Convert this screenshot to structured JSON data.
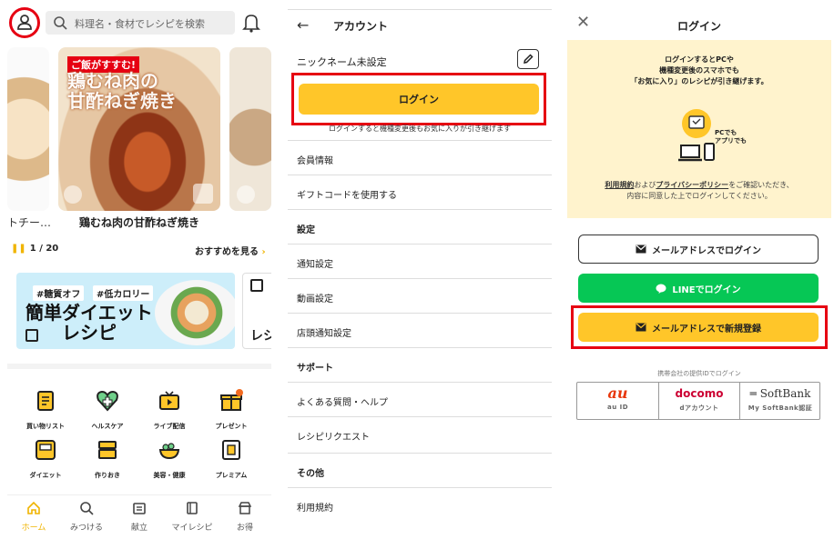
{
  "home": {
    "search_placeholder": "料理名・食材でレシピを検索",
    "featured_badge": "ご飯がすすむ!",
    "featured_title_line1": "鶏むね肉の",
    "featured_title_line2": "甘酢ねぎ焼き",
    "featured_caption": "鶏むね肉の甘酢ねぎ焼き",
    "left_caption": "トチー…",
    "pager": "1 / 20",
    "see_more": "おすすめを見る",
    "banner_tag1": "#糖質オフ",
    "banner_tag2": "#低カロリー",
    "banner_title_line1": "簡単ダイエット",
    "banner_title_line2": "レシピ",
    "banner2_text": "レシ",
    "grid": [
      {
        "label": "買い物リスト",
        "icon": "shopping-list-icon"
      },
      {
        "label": "ヘルスケア",
        "icon": "healthcare-icon"
      },
      {
        "label": "ライブ配信",
        "icon": "live-tv-icon"
      },
      {
        "label": "プレゼント",
        "icon": "present-icon",
        "badge": "N"
      },
      {
        "label": "ダイエット",
        "icon": "scale-icon"
      },
      {
        "label": "作りおき",
        "icon": "containers-icon"
      },
      {
        "label": "美容・健康",
        "icon": "salad-bowl-icon"
      },
      {
        "label": "プレミアム",
        "icon": "premium-icon"
      }
    ],
    "tabs": [
      "ホーム",
      "みつける",
      "献立",
      "マイレシピ",
      "お得"
    ],
    "accent": "#f0b400",
    "highlight": "#e60012"
  },
  "account": {
    "title": "アカウント",
    "nickname": "ニックネーム未設定",
    "login_label": "ログイン",
    "login_note": "ログインすると機種変更後もお気に入りが引き継げます",
    "menu": [
      {
        "label": "会員情報",
        "section": false
      },
      {
        "label": "ギフトコードを使用する",
        "section": false
      },
      {
        "label": "設定",
        "section": true
      },
      {
        "label": "通知設定",
        "section": false
      },
      {
        "label": "動画設定",
        "section": false
      },
      {
        "label": "店頭通知設定",
        "section": false
      },
      {
        "label": "サポート",
        "section": true
      },
      {
        "label": "よくある質問・ヘルプ",
        "section": false
      },
      {
        "label": "レシピリクエスト",
        "section": false
      },
      {
        "label": "その他",
        "section": true
      },
      {
        "label": "利用規約",
        "section": false
      }
    ],
    "button_color": "#ffc629"
  },
  "login": {
    "title": "ログイン",
    "info_line1": "ログインするとPCや",
    "info_line2": "機種変更後のスマホでも",
    "info_line3": "「お気に入り」のレシピが引き継げます。",
    "illu_text1": "PCでも",
    "illu_text2": "アプリでも",
    "legal_link1": "利用規約",
    "legal_mid": "および",
    "legal_link2": "プライバシーポリシー",
    "legal_after": "をご確認いただき、",
    "legal_line2": "内容に同意した上でログインしてください。",
    "mail_login": "メールアドレスでログイン",
    "line_login": "LINEでログイン",
    "mail_signup": "メールアドレスで新規登録",
    "carrier_note": "携帯会社の提供IDでログイン",
    "carriers": [
      {
        "name": "au",
        "sub": "au ID",
        "color": "#e8380d"
      },
      {
        "name": "docomo",
        "sub": "dアカウント",
        "color": "#cc0033"
      },
      {
        "name": "SoftBank",
        "sub": "My SoftBank認証",
        "color": "#333333"
      }
    ],
    "line_color": "#06c755",
    "info_bg": "#fff3cd"
  }
}
